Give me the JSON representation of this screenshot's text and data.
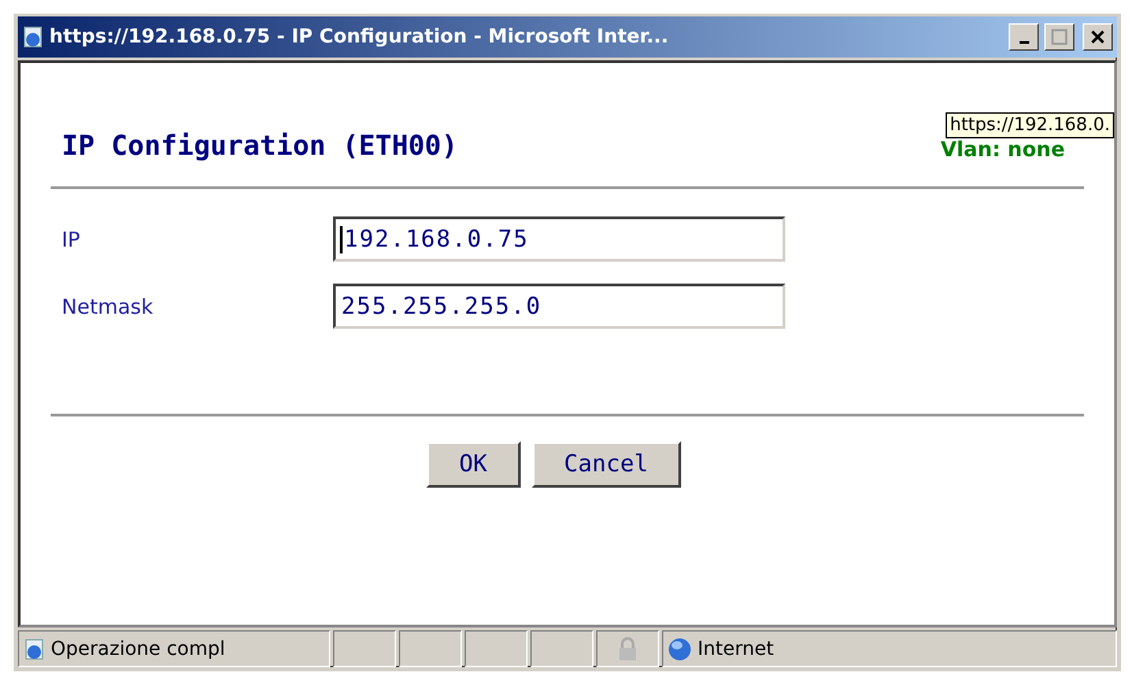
{
  "window": {
    "title": "https://192.168.0.75 - IP Configuration - Microsoft Inter..."
  },
  "heading": "IP Configuration (ETH00)",
  "vlan": "Vlan: none",
  "tooltip": "https://192.168.0.",
  "fields": [
    {
      "label": "IP",
      "value": "192.168.0.75",
      "focused": true
    },
    {
      "label": "Netmask",
      "value": "255.255.255.0",
      "focused": false
    }
  ],
  "buttons": [
    "OK",
    "Cancel"
  ],
  "status_bar": {
    "message": "Operazione compl",
    "zone": "Internet"
  }
}
